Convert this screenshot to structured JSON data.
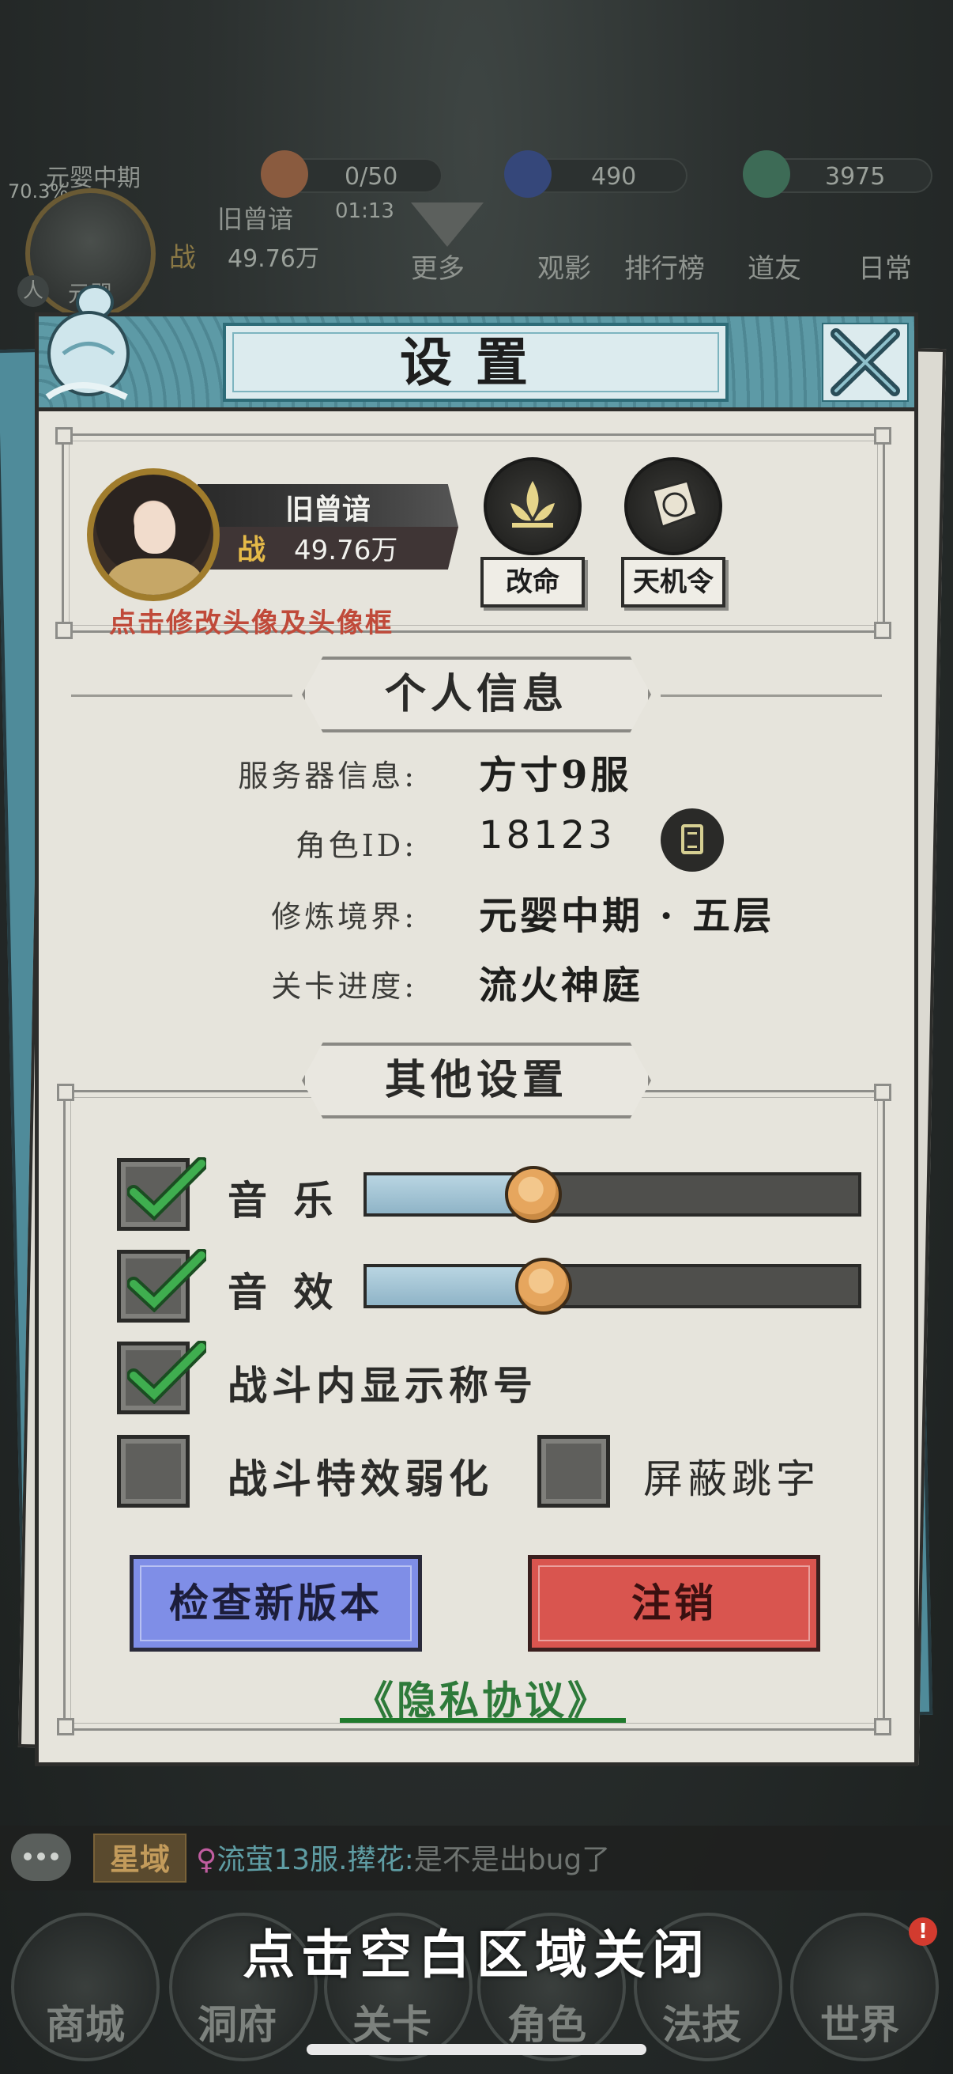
{
  "hud": {
    "realm": "元婴中期",
    "percent": "70.3%",
    "player_name": "旧曾谙",
    "timer": "01:13",
    "power_icon": "战",
    "power": "49.76万",
    "resources": [
      {
        "icon": "peach-icon",
        "value": "0/50"
      },
      {
        "icon": "blue-gem-icon",
        "value": "490"
      },
      {
        "icon": "jade-icon",
        "value": "3975"
      }
    ],
    "top_menu": [
      "更多",
      "观影",
      "排行榜",
      "道友",
      "日常"
    ],
    "side_tag": "人",
    "side_tag_text": "元婴"
  },
  "dialog": {
    "title": "设置",
    "close_icon": "close-x-icon",
    "profile": {
      "name": "旧曾谙",
      "power_icon": "战",
      "power": "49.76万",
      "edit_hint": "点击修改头像及头像框",
      "buttons": [
        {
          "icon": "lotus-emblem-icon",
          "label": "改命"
        },
        {
          "icon": "token-scroll-icon",
          "label": "天机令"
        }
      ]
    },
    "personal_section_title": "个人信息",
    "info": [
      {
        "label": "服务器信息:",
        "value": "方寸9服"
      },
      {
        "label": "角色ID:",
        "value": "18123"
      },
      {
        "label": "修炼境界:",
        "value": "元婴中期 · 五层"
      },
      {
        "label": "关卡进度:",
        "value": "流火神庭"
      }
    ],
    "copy_icon": "copy-document-icon",
    "other_section_title": "其他设置",
    "music": {
      "label": "音 乐",
      "checked": true,
      "level": 0.34
    },
    "sfx": {
      "label": "音 效",
      "checked": true,
      "level": 0.36
    },
    "show_title": {
      "label": "战斗内显示称号",
      "checked": true
    },
    "weaken_effects": {
      "label": "战斗特效弱化",
      "checked": false
    },
    "block_damage_text": {
      "label": "屏蔽跳字",
      "checked": false
    },
    "check_version_label": "检查新版本",
    "logout_label": "注销",
    "privacy_label": "《隐私协议》",
    "colors": {
      "check_version": "#7f8ee7",
      "logout": "#d9554f",
      "privacy": "#2e7a3a",
      "checkmark": "#3fae4f"
    }
  },
  "chat": {
    "channel": "星域",
    "gender_icon": "♀",
    "sender": "流萤13服.撵花:",
    "message": "是不是出bug了"
  },
  "close_hint": "点击空白区域关闭",
  "bottom_nav": [
    "商城",
    "洞府",
    "关卡",
    "角色",
    "法技",
    "世界"
  ],
  "bottom_nav_badge": "!"
}
